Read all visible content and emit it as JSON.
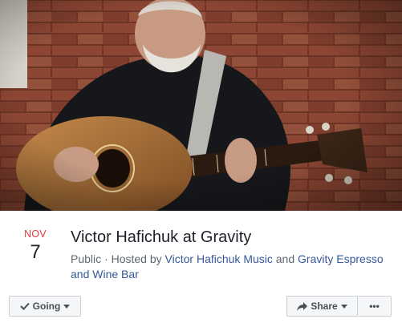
{
  "event": {
    "month": "NOV",
    "day": "7",
    "title": "Victor Hafichuk at Gravity",
    "visibility": "Public",
    "hosted_prefix": "Hosted by",
    "host_1": "Victor Hafichuk Music",
    "host_joiner": "and",
    "host_2": "Gravity Espresso and Wine Bar"
  },
  "actions": {
    "going_label": "Going",
    "share_label": "Share",
    "more_label": "•••"
  },
  "icons": {
    "going": "checkmark-icon",
    "share": "share-arrow-icon",
    "dropdown": "caret-down-icon"
  },
  "colors": {
    "month": "#e0393e",
    "link": "#365899",
    "button_bg": "#f5f6f7",
    "button_border": "#ccd0d5"
  }
}
